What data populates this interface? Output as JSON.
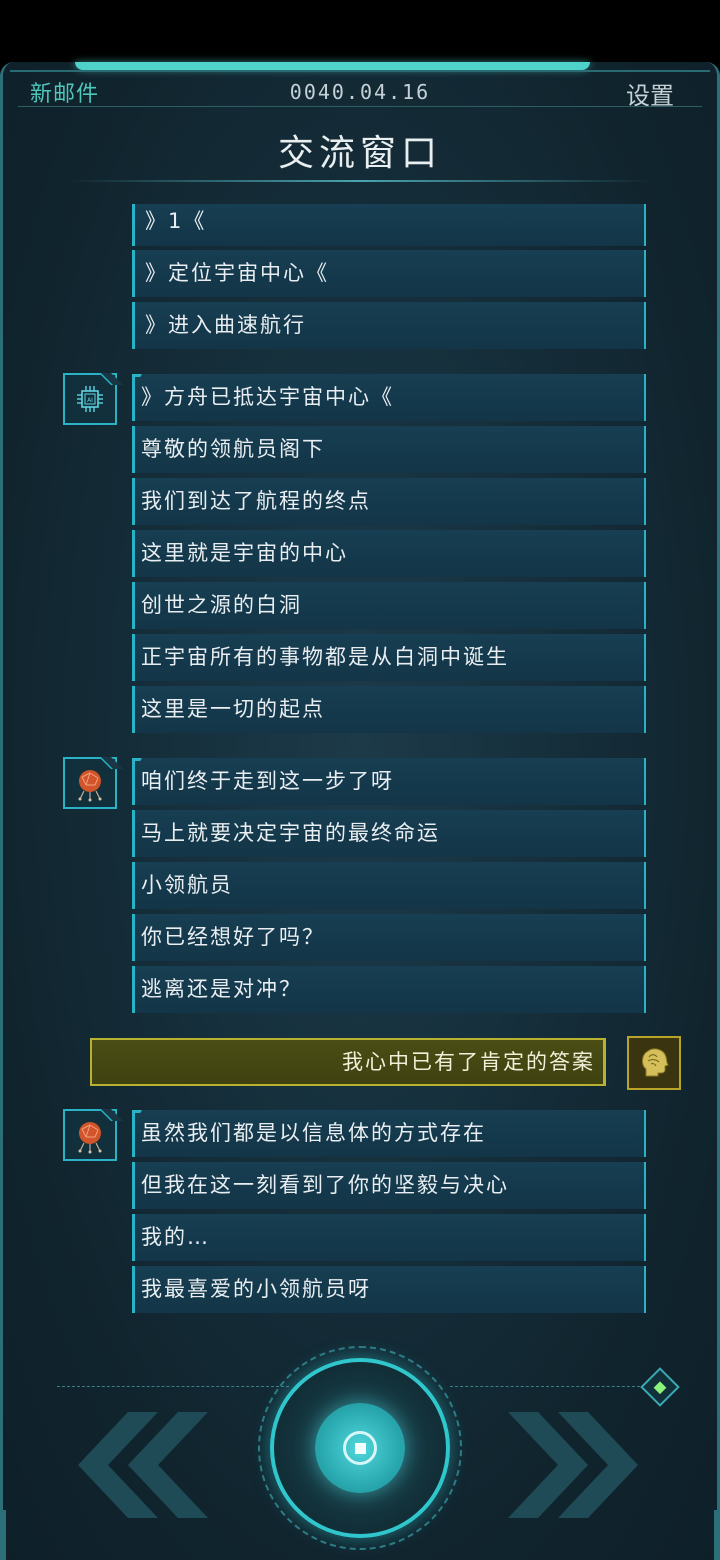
{
  "header": {
    "left_label": "新邮件",
    "date": "0040.04.16",
    "right_label": "设置",
    "title": "交流窗口"
  },
  "options": [
    "》1《",
    "》定位宇宙中心《",
    "》进入曲速航行"
  ],
  "ai_group": {
    "avatar_icon": "ai-chip-icon",
    "messages": [
      "》方舟已抵达宇宙中心《",
      "尊敬的领航员阁下",
      "我们到达了航程的终点",
      "这里就是宇宙的中心",
      "创世之源的白洞",
      "正宇宙所有的事物都是从白洞中诞生",
      "这里是一切的起点"
    ]
  },
  "character_group_1": {
    "avatar_icon": "brain-network-icon",
    "messages": [
      "咱们终于走到这一步了呀",
      "马上就要决定宇宙的最终命运",
      "小领航员",
      "你已经想好了吗？",
      "逃离还是对冲？"
    ]
  },
  "player": {
    "avatar_icon": "player-head-icon",
    "message": "我心中已有了肯定的答案"
  },
  "character_group_2": {
    "avatar_icon": "brain-network-icon",
    "messages": [
      "虽然我们都是以信息体的方式存在",
      "但我在这一刻看到了你的坚毅与决心",
      "我的…",
      "我最喜爱的小领航员呀"
    ]
  },
  "controls": {
    "prev_icon": "double-chevron-left-icon",
    "next_icon": "double-chevron-right-icon",
    "center_icon": "record-button-icon",
    "corner_icon": "diamond-indicator-icon"
  },
  "colors": {
    "accent": "#2ab3c6",
    "player_accent": "#b9b230",
    "background": "#11252f"
  }
}
